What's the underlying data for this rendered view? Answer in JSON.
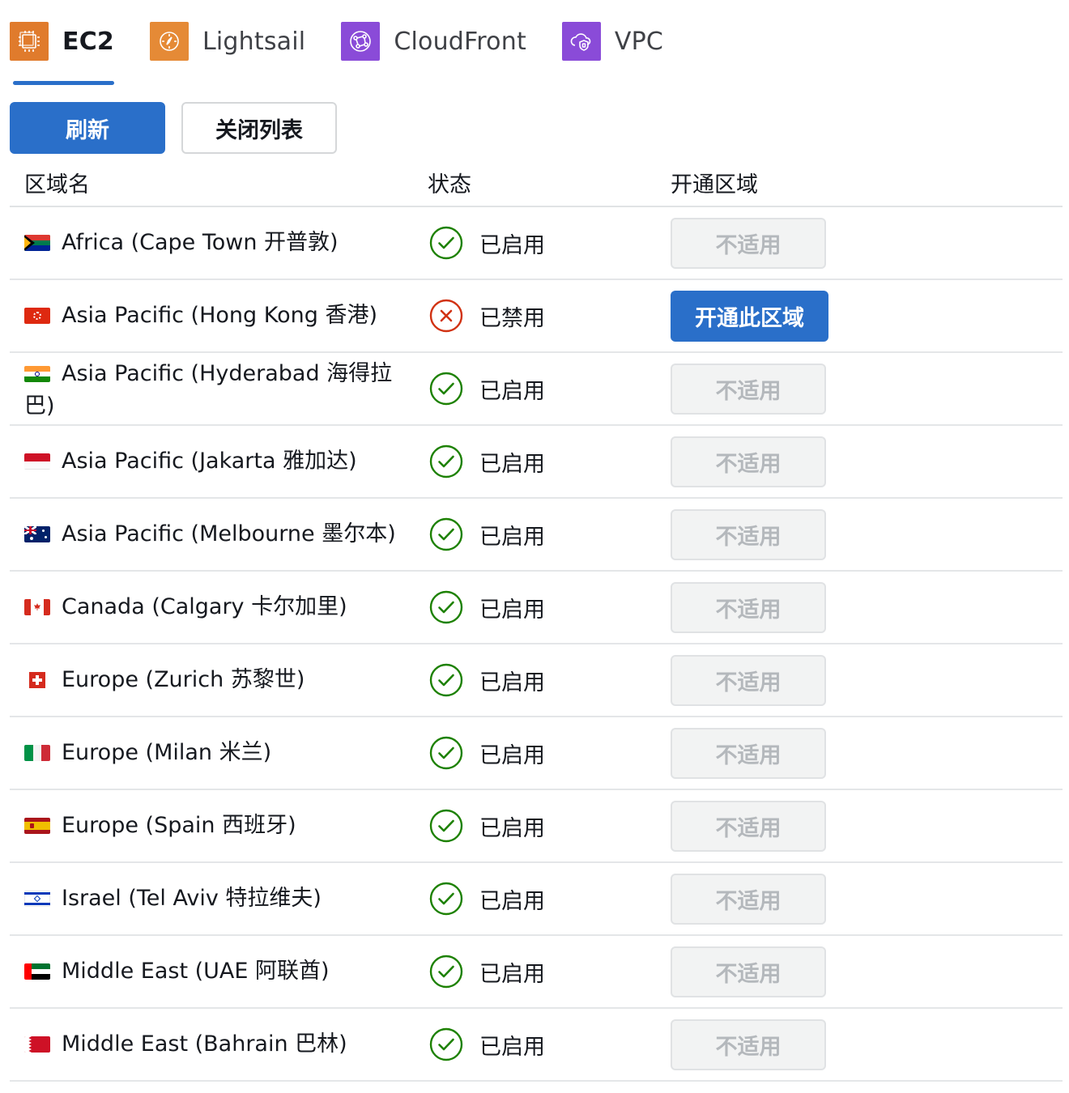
{
  "colors": {
    "primary": "#2a6fc9",
    "ec2_orange": "#e07b2c",
    "lightsail_orange": "#e58a36",
    "purple": "#8a4bd8",
    "enabled_green": "#1d8102",
    "disabled_red": "#d13212"
  },
  "tabs": [
    {
      "label": "EC2",
      "icon": "ec2-chip-icon",
      "active": true
    },
    {
      "label": "Lightsail",
      "icon": "lightsail-compass-icon",
      "active": false
    },
    {
      "label": "CloudFront",
      "icon": "cloudfront-network-icon",
      "active": false
    },
    {
      "label": "VPC",
      "icon": "vpc-cloud-shield-icon",
      "active": false
    }
  ],
  "toolbar": {
    "refresh_label": "刷新",
    "close_list_label": "关闭列表"
  },
  "table": {
    "headers": {
      "region": "区域名",
      "status": "状态",
      "action": "开通区域"
    },
    "rows": [
      {
        "flag": "south-africa-flag",
        "region": "Africa (Cape Town 开普敦)",
        "status": "已启用",
        "status_type": "enabled",
        "action": "不适用",
        "action_enabled": false
      },
      {
        "flag": "hong-kong-flag",
        "region": "Asia Pacific (Hong Kong 香港)",
        "status": "已禁用",
        "status_type": "disabled",
        "action": "开通此区域",
        "action_enabled": true
      },
      {
        "flag": "india-flag",
        "region": "Asia Pacific (Hyderabad 海得拉巴)",
        "status": "已启用",
        "status_type": "enabled",
        "action": "不适用",
        "action_enabled": false
      },
      {
        "flag": "indonesia-flag",
        "region": "Asia Pacific (Jakarta 雅加达)",
        "status": "已启用",
        "status_type": "enabled",
        "action": "不适用",
        "action_enabled": false
      },
      {
        "flag": "australia-flag",
        "region": "Asia Pacific (Melbourne 墨尔本)",
        "status": "已启用",
        "status_type": "enabled",
        "action": "不适用",
        "action_enabled": false
      },
      {
        "flag": "canada-flag",
        "region": "Canada (Calgary 卡尔加里)",
        "status": "已启用",
        "status_type": "enabled",
        "action": "不适用",
        "action_enabled": false
      },
      {
        "flag": "switzerland-flag",
        "region": "Europe (Zurich 苏黎世)",
        "status": "已启用",
        "status_type": "enabled",
        "action": "不适用",
        "action_enabled": false
      },
      {
        "flag": "italy-flag",
        "region": "Europe (Milan 米兰)",
        "status": "已启用",
        "status_type": "enabled",
        "action": "不适用",
        "action_enabled": false
      },
      {
        "flag": "spain-flag",
        "region": "Europe (Spain 西班牙)",
        "status": "已启用",
        "status_type": "enabled",
        "action": "不适用",
        "action_enabled": false
      },
      {
        "flag": "israel-flag",
        "region": "Israel (Tel Aviv 特拉维夫)",
        "status": "已启用",
        "status_type": "enabled",
        "action": "不适用",
        "action_enabled": false
      },
      {
        "flag": "uae-flag",
        "region": "Middle East (UAE 阿联酋)",
        "status": "已启用",
        "status_type": "enabled",
        "action": "不适用",
        "action_enabled": false
      },
      {
        "flag": "bahrain-flag",
        "region": "Middle East (Bahrain 巴林)",
        "status": "已启用",
        "status_type": "enabled",
        "action": "不适用",
        "action_enabled": false
      }
    ]
  }
}
